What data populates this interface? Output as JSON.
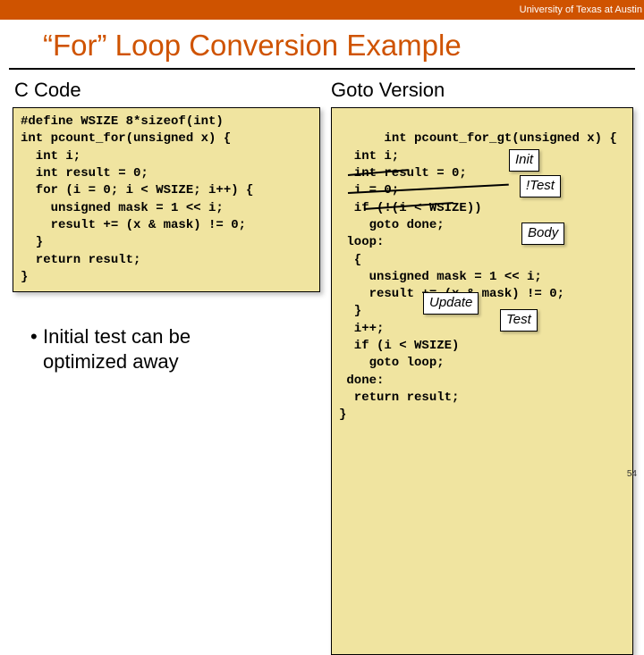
{
  "header": {
    "university": "University of Texas at Austin"
  },
  "title": "“For” Loop Conversion Example",
  "left": {
    "heading": "C Code",
    "code": "#define WSIZE 8*sizeof(int)\nint pcount_for(unsigned x) {\n  int i;\n  int result = 0;\n  for (i = 0; i < WSIZE; i++) {\n    unsigned mask = 1 << i;\n    result += (x & mask) != 0;\n  }\n  return result;\n}"
  },
  "right": {
    "heading": "Goto Version",
    "code": "int pcount_for_gt(unsigned x) {\n  int i;\n  int result = 0;\n  i = 0;\n  if (!(i < WSIZE))\n    goto done;\n loop:\n  {\n    unsigned mask = 1 << i;\n    result += (x & mask) != 0;\n  }\n  i++;\n  if (i < WSIZE)\n    goto loop;\n done:\n  return result;\n}"
  },
  "annotations": {
    "init": "Init",
    "not_test": "!Test",
    "body": "Body",
    "update": "Update",
    "test": "Test"
  },
  "bullet": {
    "line1": "Initial test can be",
    "line2": "optimized away"
  },
  "pagenum": "54"
}
